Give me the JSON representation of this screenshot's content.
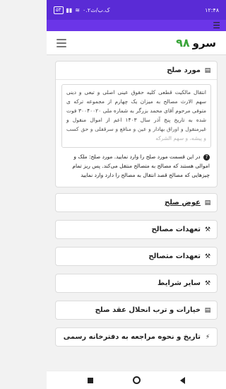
{
  "status_bar": {
    "time": "۱۲:۴۸",
    "network": "۰.۲ک.ب/ث",
    "battery": "۵۳"
  },
  "header": {
    "logo_text": "سرو",
    "logo_number": "۹۸"
  },
  "subject_card": {
    "title": "مورد صلح",
    "text": "انتقال مالکیت قطعی کلیه حقوق عینی اصلی و تبعی و دینی سهم الارث مصالح به میزان یک چهارم از مجموعه ترکه ی متوفی مرحوم آقای محمد بزرگر به شماره ملی ۳۰۰۴۰۰۲۰ فوت شده به تاریخ پنج آذر سال ۱۴۰۳ اعم از اموال منقول و غیرمنقول و اوراق بهادار و عین و منافع و سرقفلی و حق کسب و پیشه، و سهم الشرکه",
    "hint": "در این قسمت مورد صلح را وارد نمایید. مورد صلح: ملک و اموالی هستند که مصالح به متصالح منتقل می‌کند. پس ریز تمام چیزهایی که مصالح قصد انتقال به مصالح را دارد وارد نمایید"
  },
  "sections": [
    {
      "label": "عوض صلح",
      "icon": "book-icon"
    },
    {
      "label": "تعهدات مصالح",
      "icon": "gavel-icon"
    },
    {
      "label": "تعهدات متصالح",
      "icon": "gavel-icon"
    },
    {
      "label": "سایر شرایط",
      "icon": "gavel-icon"
    },
    {
      "label": "خیارات و ترب انحلال عقد صلح",
      "icon": "book-icon"
    },
    {
      "label": "تاریخ و نحوه مراجعه به دفترخانه رسمی",
      "icon": "bolt-icon"
    }
  ]
}
